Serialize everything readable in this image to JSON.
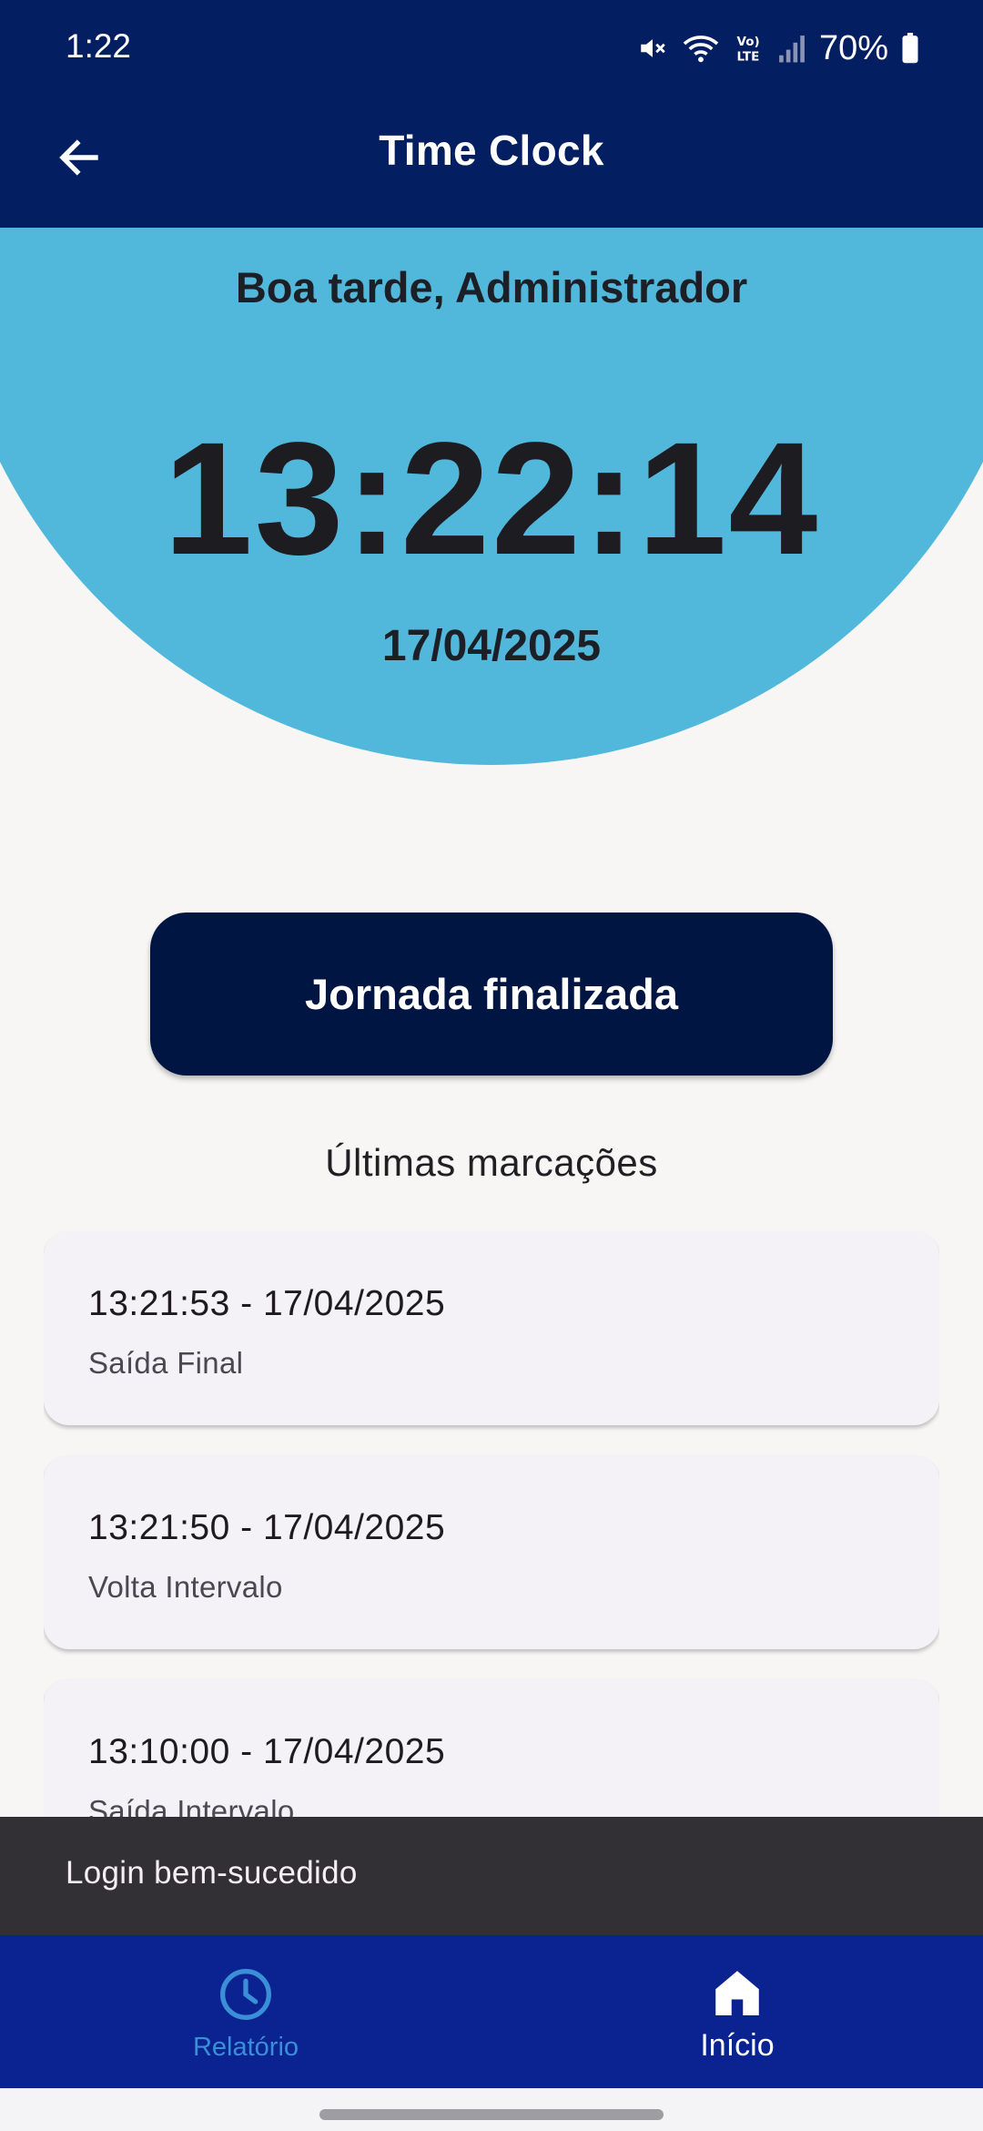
{
  "status_bar": {
    "time": "1:22",
    "battery": "70%",
    "icons": [
      "mute-icon",
      "wifi-icon",
      "volte-icon",
      "signal-icon",
      "battery-icon"
    ]
  },
  "app_bar": {
    "title": "Time Clock",
    "back_icon": "arrow-left-icon"
  },
  "hero": {
    "greeting": "Boa tarde, Administrador",
    "clock": "13:22:14",
    "date": "17/04/2025"
  },
  "status_button": {
    "label": "Jornada finalizada"
  },
  "records": {
    "title": "Últimas marcações",
    "items": [
      {
        "datetime": "13:21:53 - 17/04/2025",
        "type": "Saída Final"
      },
      {
        "datetime": "13:21:50 - 17/04/2025",
        "type": "Volta Intervalo"
      },
      {
        "datetime": "13:10:00 - 17/04/2025",
        "type": "Saída Intervalo"
      }
    ]
  },
  "snackbar": {
    "message": "Login bem-sucedido"
  },
  "bottom_nav": {
    "items": [
      {
        "label": "Relatório",
        "icon": "clock-icon",
        "selected": false
      },
      {
        "label": "Início",
        "icon": "home-icon",
        "selected": true
      }
    ]
  },
  "colors": {
    "app_bar": "#041e62",
    "hero": "#52b8db",
    "button": "#001541",
    "nav": "#0a2391",
    "nav_inactive": "#3a8fd6"
  }
}
